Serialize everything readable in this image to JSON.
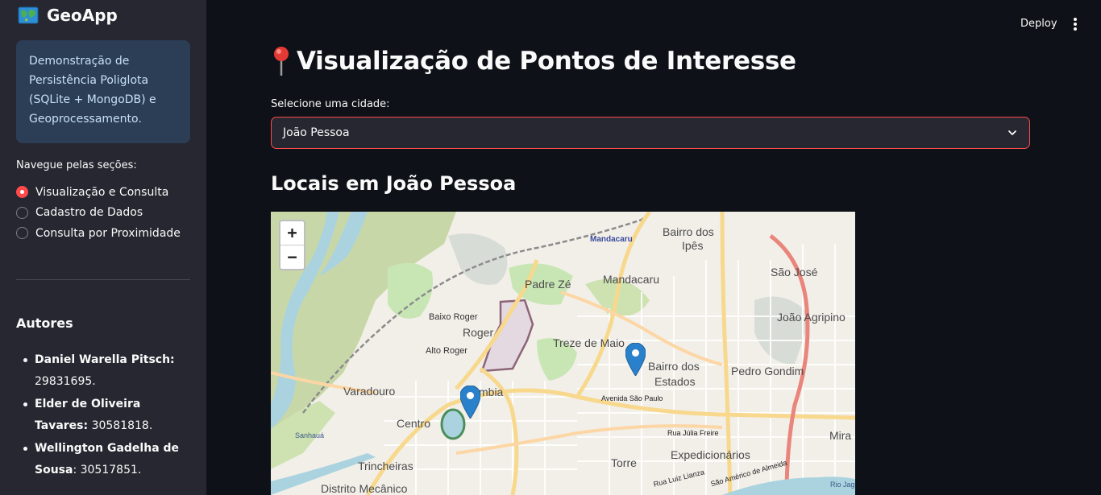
{
  "sidebar": {
    "app_title": "GeoApp",
    "info_text": "Demonstração de Persistência Poliglota (SQLite + MongoDB) e Geoprocessamento.",
    "nav_label": "Navegue pelas seções:",
    "nav_options": [
      {
        "label": "Visualização e Consulta",
        "selected": true
      },
      {
        "label": "Cadastro de Dados",
        "selected": false
      },
      {
        "label": "Consulta por Proximidade",
        "selected": false
      }
    ],
    "authors_title": "Autores",
    "authors": [
      {
        "name": "Daniel Warella Pitsch:",
        "id": "29831695."
      },
      {
        "name": "Elder de Oliveira Tavares:",
        "id": "30581818."
      },
      {
        "name": "Wellington Gadelha de Sousa",
        "id": ": 30517851."
      }
    ]
  },
  "header": {
    "deploy_label": "Deploy"
  },
  "main": {
    "title": "Visualização de Pontos de Interesse",
    "select_label": "Selecione uma cidade:",
    "select_value": "João Pessoa",
    "section_title": "Locais em João Pessoa"
  },
  "map": {
    "zoom_in": "+",
    "zoom_out": "−",
    "labels": {
      "mandacaru_blue": "Mandacaru",
      "bairro_ipes_1": "Bairro dos",
      "bairro_ipes_2": "Ipês",
      "sao_jose": "São José",
      "padre_ze": "Padre Zé",
      "mandacaru": "Mandacaru",
      "joao_agripino": "João Agripino",
      "baixo_roger": "Baixo Roger",
      "roger": "Roger",
      "treze_de_maio": "Treze de Maio",
      "alto_roger": "Alto Roger",
      "bairro_estados_1": "Bairro dos",
      "bairro_estados_2": "Estados",
      "pedro_gondim": "Pedro Gondim",
      "varadouro": "Varadouro",
      "tambia": "mbia",
      "avenida_sao_paulo": "Avenida São Paulo",
      "centro": "Centro",
      "sanhaua": "Sanhauá",
      "rua_julia_freire": "Rua Júlia Freire",
      "mira": "Mira",
      "expedicionarios": "Expedicionários",
      "trincheiras": "Trincheiras",
      "torre": "Torre",
      "distrito_mecanico": "Distrito Mecânico",
      "rua_luiz_lianza": "Rua Luiz Lianza",
      "sao_americo": "São Américo de Almeida",
      "rio_jag": "Rio Jag"
    }
  },
  "colors": {
    "accent": "#ff4b4b",
    "sidebar_bg": "#262730",
    "main_bg": "#0e1117",
    "info_bg": "#2c3e56",
    "marker": "#2a81cb"
  }
}
